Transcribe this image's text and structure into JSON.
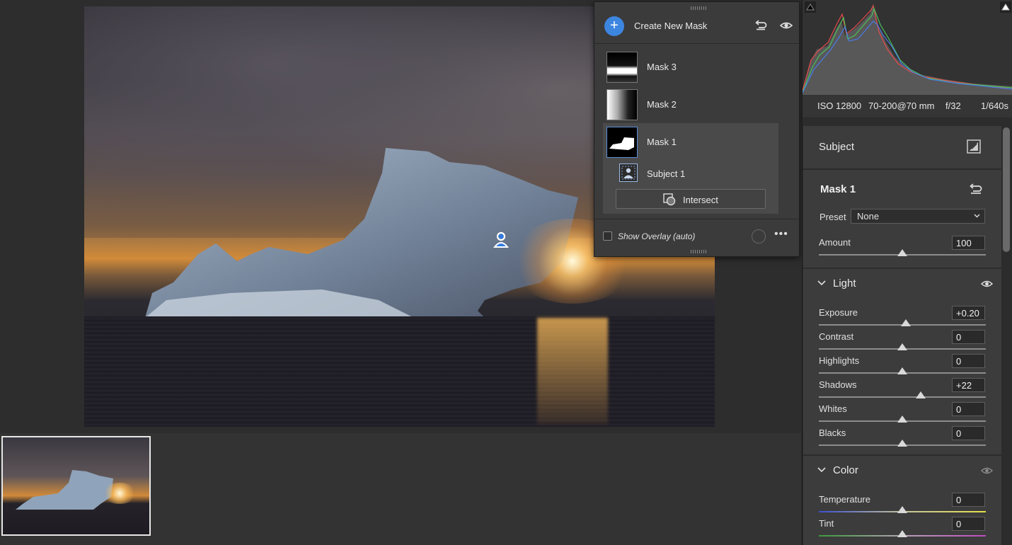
{
  "mask_panel": {
    "create_label": "Create New Mask",
    "masks": [
      {
        "label": "Mask 3"
      },
      {
        "label": "Mask 2"
      },
      {
        "label": "Mask 1"
      }
    ],
    "component": "Subject 1",
    "intersect_label": "Intersect",
    "overlay_label": "Show Overlay (auto)",
    "more_label": "•••"
  },
  "exif": {
    "iso": "ISO 12800",
    "lens": "70-200@70 mm",
    "aperture": "f/32",
    "shutter": "1/640s"
  },
  "subject_section": {
    "title": "Subject"
  },
  "mask_section": {
    "title": "Mask 1",
    "preset_label": "Preset",
    "preset_value": "None",
    "amount": {
      "label": "Amount",
      "value": "100",
      "position": 0.5
    }
  },
  "light": {
    "title": "Light",
    "sliders": [
      {
        "label": "Exposure",
        "value": "+0.20",
        "position": 0.52
      },
      {
        "label": "Contrast",
        "value": "0",
        "position": 0.5
      },
      {
        "label": "Highlights",
        "value": "0",
        "position": 0.5
      },
      {
        "label": "Shadows",
        "value": "+22",
        "position": 0.61
      },
      {
        "label": "Whites",
        "value": "0",
        "position": 0.5
      },
      {
        "label": "Blacks",
        "value": "0",
        "position": 0.5
      }
    ]
  },
  "color": {
    "title": "Color",
    "sliders": [
      {
        "label": "Temperature",
        "value": "0",
        "position": 0.5
      },
      {
        "label": "Tint",
        "value": "0",
        "position": 0.5
      }
    ]
  },
  "colors": {
    "accent": "#3d86e0",
    "panel": "#3c3c3c"
  }
}
